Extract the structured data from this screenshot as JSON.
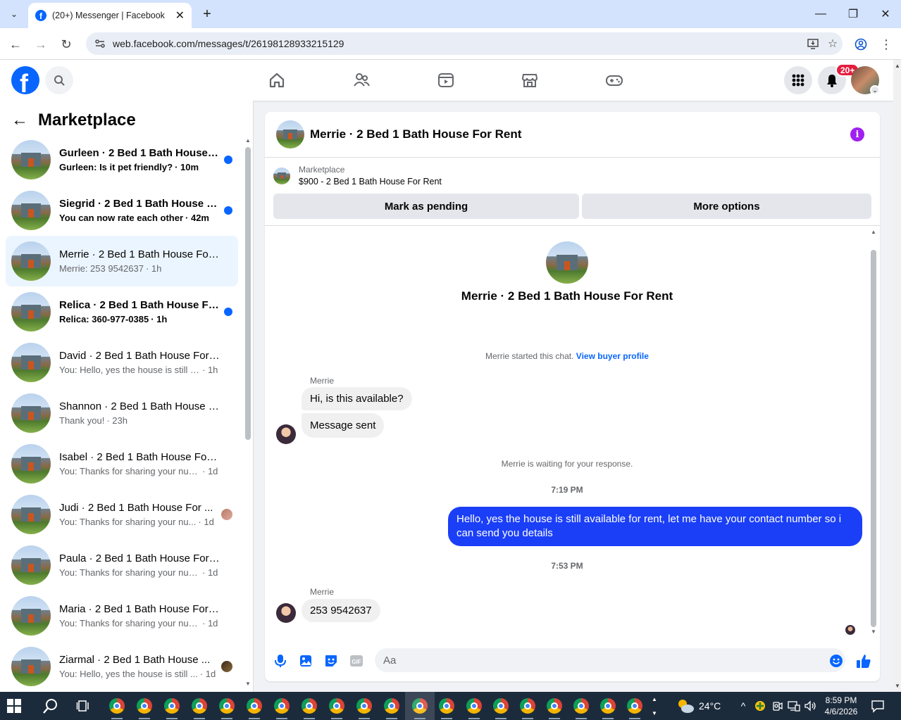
{
  "browser": {
    "tab_title": "(20+) Messenger | Facebook",
    "url": "web.facebook.com/messages/t/26198128933215129"
  },
  "header": {
    "notification_badge": "20+"
  },
  "sidebar": {
    "title": "Marketplace",
    "conversations": [
      {
        "name": "Gurleen · 2 Bed 1 Bath House F...",
        "preview": "Gurleen: Is it pet friendly?",
        "time": "· 10m",
        "unread": true,
        "indicator": "dot"
      },
      {
        "name": "Siegrid · 2 Bed 1 Bath House F...",
        "preview": "You can now rate each other",
        "time": "· 42m",
        "unread": true,
        "indicator": "dot"
      },
      {
        "name": "Merrie · 2 Bed 1 Bath House For ...",
        "preview": "Merrie: 253 9542637",
        "time": "· 1h",
        "unread": false,
        "active": true,
        "indicator": "none"
      },
      {
        "name": "Relica · 2 Bed 1 Bath House Fo...",
        "preview": "Relica: 360-977-0385",
        "time": "· 1h",
        "unread": true,
        "indicator": "dot"
      },
      {
        "name": "David · 2 Bed 1 Bath House For ...",
        "preview": "You: Hello, yes the house is still avai...",
        "time": "· 1h",
        "unread": false,
        "indicator": "none"
      },
      {
        "name": "Shannon · 2 Bed 1 Bath House F...",
        "preview": "Thank you!",
        "time": "· 23h",
        "unread": false,
        "indicator": "none"
      },
      {
        "name": "Isabel · 2 Bed 1 Bath House For ...",
        "preview": "You: Thanks for sharing your numb...",
        "time": "· 1d",
        "unread": false,
        "indicator": "none"
      },
      {
        "name": "Judi · 2 Bed 1 Bath House For ...",
        "preview": "You: Thanks for sharing your nu...",
        "time": "· 1d",
        "unread": false,
        "indicator": "avatar"
      },
      {
        "name": "Paula · 2 Bed 1 Bath House For R...",
        "preview": "You: Thanks for sharing your numb...",
        "time": "· 1d",
        "unread": false,
        "indicator": "none"
      },
      {
        "name": "Maria · 2 Bed 1 Bath House For ...",
        "preview": "You: Thanks for sharing your numb...",
        "time": "· 1d",
        "unread": false,
        "indicator": "none"
      },
      {
        "name": "Ziarmal · 2 Bed 1 Bath House ...",
        "preview": "You: Hello, yes the house is still ...",
        "time": "· 1d",
        "unread": false,
        "indicator": "avatar-dark"
      }
    ]
  },
  "chat": {
    "title": "Merrie · 2 Bed 1 Bath House For Rent",
    "listing_category": "Marketplace",
    "listing_title": "$900 - 2 Bed 1 Bath House For Rent",
    "mark_pending_label": "Mark as pending",
    "more_options_label": "More options",
    "intro_name": "Merrie · 2 Bed 1 Bath House For Rent",
    "started_text": "Merrie started this chat.",
    "view_profile_label": "View buyer profile",
    "sender_1": "Merrie",
    "msg_1": "Hi, is this available?",
    "msg_2": "Message sent",
    "waiting_text": "Merrie is waiting for your response.",
    "time_1": "7:19 PM",
    "msg_out": "Hello, yes the house is still available for rent, let me have your contact number so i can send you  details",
    "time_2": "7:53 PM",
    "sender_2": "Merrie",
    "msg_3": "253 9542637",
    "composer_placeholder": "Aa"
  },
  "taskbar": {
    "temperature": "24°C",
    "time": "8:59 PM",
    "date": "4/6/2026"
  }
}
